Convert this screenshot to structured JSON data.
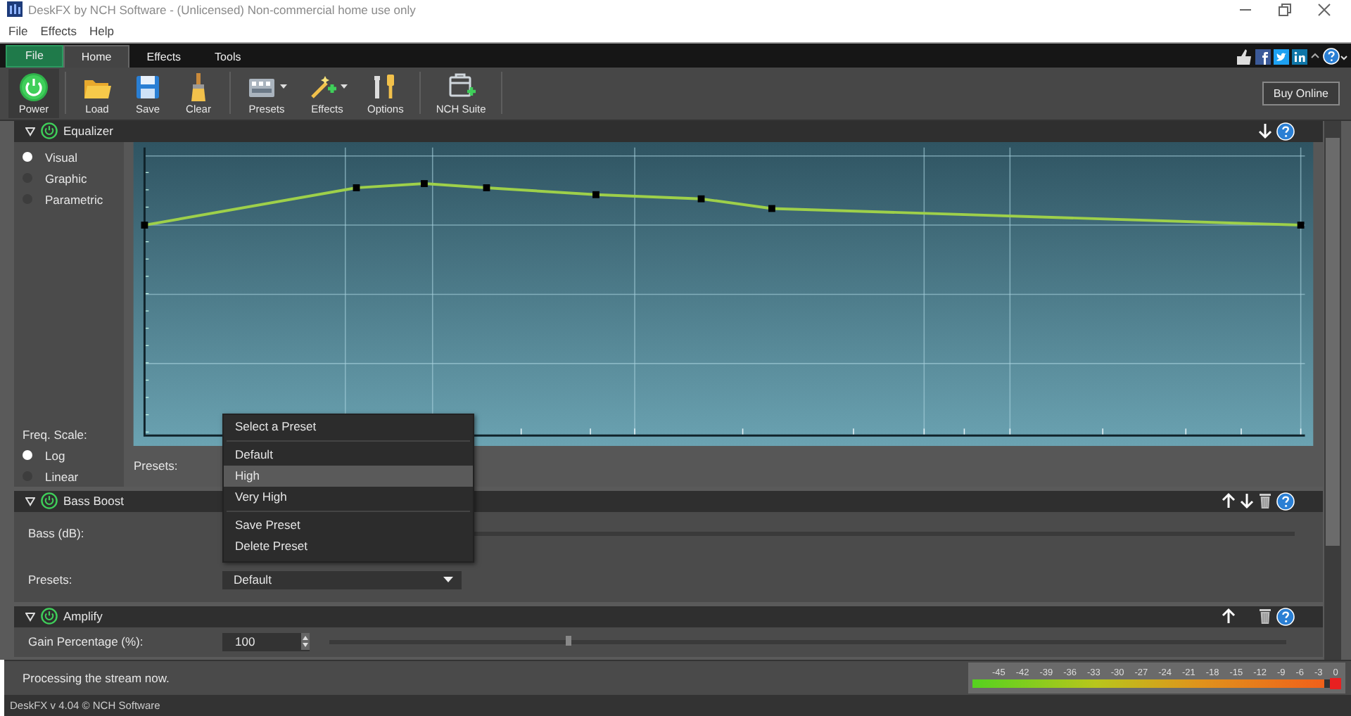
{
  "window": {
    "title": "DeskFX by NCH Software - (Unlicensed) Non-commercial home use only"
  },
  "menu_bar": [
    "File",
    "Effects",
    "Help"
  ],
  "ribbon_tabs": [
    {
      "label": "File",
      "kind": "file",
      "selected": false
    },
    {
      "label": "Home",
      "kind": "tab",
      "selected": true
    },
    {
      "label": "Effects",
      "kind": "tab",
      "selected": false
    },
    {
      "label": "Tools",
      "kind": "tab",
      "selected": false
    }
  ],
  "toolbar_groups": [
    [
      {
        "label": "Power",
        "dropdown": false
      }
    ],
    [
      {
        "label": "Load",
        "dropdown": false
      },
      {
        "label": "Save",
        "dropdown": false
      },
      {
        "label": "Clear",
        "dropdown": false
      }
    ],
    [
      {
        "label": "Presets",
        "dropdown": true
      },
      {
        "label": "Effects",
        "dropdown": true
      },
      {
        "label": "Options",
        "dropdown": false
      }
    ],
    [
      {
        "label": "NCH Suite",
        "dropdown": false
      }
    ]
  ],
  "buy_button": "Buy Online",
  "effects": [
    {
      "kind": "equalizer",
      "title": "Equalizer",
      "enabled": true,
      "can_move_up": false,
      "can_move_down": true,
      "can_delete": false,
      "modes": [
        {
          "label": "Visual",
          "selected": true
        },
        {
          "label": "Graphic",
          "selected": false
        },
        {
          "label": "Parametric",
          "selected": false
        }
      ],
      "freq_scale_label": "Freq. Scale:",
      "scales": [
        {
          "label": "Log",
          "selected": true
        },
        {
          "label": "Linear",
          "selected": false
        }
      ],
      "presets_label": "Presets:"
    },
    {
      "kind": "bass",
      "title": "Bass Boost",
      "enabled": true,
      "can_move_up": true,
      "can_move_down": true,
      "can_delete": true,
      "bass_label": "Bass (dB):",
      "presets_label": "Presets:",
      "preset_value": "Default"
    },
    {
      "kind": "amplify",
      "title": "Amplify",
      "enabled": true,
      "can_move_up": true,
      "can_move_down": false,
      "can_delete": true,
      "gain_label": "Gain Percentage (%):",
      "gain_value": "100",
      "level": 0.25
    }
  ],
  "preset_menu": {
    "title": "Select a Preset",
    "items": [
      {
        "label": "Default",
        "selected": false
      },
      {
        "label": "High",
        "selected": true
      },
      {
        "label": "Very High",
        "selected": false
      }
    ],
    "actions": [
      "Save Preset",
      "Delete Preset"
    ]
  },
  "status_bar": {
    "message": "Processing the stream now.",
    "meter": {
      "scale": [
        "-45",
        "-42",
        "-39",
        "-36",
        "-33",
        "-30",
        "-27",
        "-24",
        "-21",
        "-18",
        "-15",
        "-12",
        "-9",
        "-6",
        "-3",
        "0"
      ],
      "level": 0.985,
      "clipping": true
    }
  },
  "footer": "DeskFX v 4.04 © NCH Software"
}
